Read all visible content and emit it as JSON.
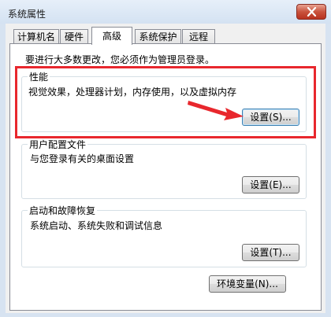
{
  "window": {
    "title": "系统属性"
  },
  "tabs": [
    {
      "label": "计算机名",
      "active": false
    },
    {
      "label": "硬件",
      "active": false
    },
    {
      "label": "高级",
      "active": true
    },
    {
      "label": "系统保护",
      "active": false
    },
    {
      "label": "远程",
      "active": false
    }
  ],
  "notice": "要进行大多数更改，您必须作为管理员登录。",
  "performance": {
    "title": "性能",
    "description": "视觉效果，处理器计划，内存使用，以及虚拟内存",
    "settings_button": "设置(S)..."
  },
  "user_profiles": {
    "title": "用户配置文件",
    "description": "与您登录有关的桌面设置",
    "settings_button": "设置(E)..."
  },
  "startup_recovery": {
    "title": "启动和故障恢复",
    "description": "系统启动、系统失败和调试信息",
    "settings_button": "设置(T)..."
  },
  "env_button": "环境变量(N)...",
  "colors": {
    "highlight": "#e8272d",
    "title_bar": "#d7e3f1"
  }
}
